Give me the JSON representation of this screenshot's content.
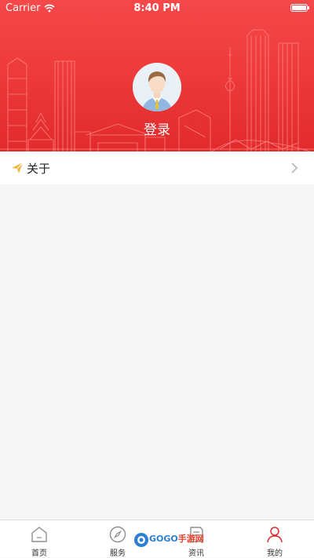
{
  "status_bar": {
    "carrier": "Carrier",
    "time": "8:40 PM"
  },
  "profile": {
    "login_label": "登录"
  },
  "menu": {
    "items": [
      {
        "label": "关于",
        "icon": "paper-plane-icon"
      }
    ]
  },
  "tabbar": {
    "tabs": [
      {
        "label": "首页",
        "icon": "home-icon"
      },
      {
        "label": "服务",
        "icon": "compass-icon"
      },
      {
        "label": "资讯",
        "icon": "document-icon"
      },
      {
        "label": "我的",
        "icon": "person-icon",
        "active": true
      }
    ]
  },
  "watermark": {
    "text_a": "GOGO",
    "text_b": "手游网"
  },
  "colors": {
    "header_red": "#ee3b3b",
    "active_tab": "#e02b2b",
    "about_icon": "#f2b33d"
  }
}
